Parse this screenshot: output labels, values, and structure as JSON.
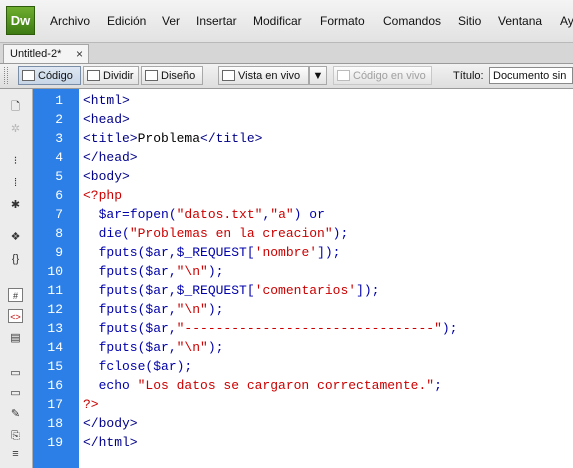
{
  "app": {
    "logo": "Dw"
  },
  "menu": [
    "Archivo",
    "Edición",
    "Ver",
    "Insertar",
    "Modificar",
    "Formato",
    "Comandos",
    "Sitio",
    "Ventana",
    "Ay"
  ],
  "tab": {
    "title": "Untitled-2*",
    "close": "×"
  },
  "toolbar": {
    "code_label": "Código",
    "split_label": "Dividir",
    "design_label": "Diseño",
    "live_view_label": "Vista en vivo",
    "live_code_label": "Código en vivo",
    "title_label": "Título:",
    "title_value": "Documento sin tí"
  },
  "colors": {
    "gutter": "#2b7fe7",
    "tag": "#000088",
    "php": "#cc0000",
    "string": "#cc0000",
    "func": "#0000aa"
  },
  "sidebar_icons": [
    "open-documents-icon",
    "show-code-navigator-icon",
    "collapse-full-tag-icon",
    "collapse-selection-icon",
    "expand-all-icon",
    "select-parent-tag-icon",
    "balance-braces-icon",
    "line-numbers-icon",
    "highlight-invalid-code-icon",
    "syntax-coloring-icon",
    "apply-comment-icon",
    "remove-comment-icon",
    "wrap-tag-icon",
    "recent-snippets-icon",
    "move-css-icon",
    "indent-code-icon"
  ],
  "code": {
    "line_numbers": [
      "1",
      "2",
      "3",
      "4",
      "5",
      "6",
      "7",
      "8",
      "9",
      "10",
      "11",
      "12",
      "13",
      "14",
      "15",
      "16",
      "17",
      "18",
      "19"
    ],
    "lines": [
      [
        {
          "t": "<html>",
          "c": "tag"
        }
      ],
      [
        {
          "t": "<head>",
          "c": "tag"
        }
      ],
      [
        {
          "t": "<title>",
          "c": "tag"
        },
        {
          "t": "Problema",
          "c": "txt"
        },
        {
          "t": "</title>",
          "c": "tag"
        }
      ],
      [
        {
          "t": "</head>",
          "c": "tag"
        }
      ],
      [
        {
          "t": "<body>",
          "c": "tag"
        }
      ],
      [
        {
          "t": "<?php",
          "c": "php"
        }
      ],
      [
        {
          "t": "  $ar=",
          "c": "fn"
        },
        {
          "t": "fopen(",
          "c": "fn"
        },
        {
          "t": "\"datos.txt\"",
          "c": "str"
        },
        {
          "t": ",",
          "c": "fn"
        },
        {
          "t": "\"a\"",
          "c": "str"
        },
        {
          "t": ") or",
          "c": "fn"
        }
      ],
      [
        {
          "t": "  die(",
          "c": "fn"
        },
        {
          "t": "\"Problemas en la creacion\"",
          "c": "str"
        },
        {
          "t": ");",
          "c": "fn"
        }
      ],
      [
        {
          "t": "  fputs($ar,$_REQUEST[",
          "c": "fn"
        },
        {
          "t": "'nombre'",
          "c": "str"
        },
        {
          "t": "]);",
          "c": "fn"
        }
      ],
      [
        {
          "t": "  fputs($ar,",
          "c": "fn"
        },
        {
          "t": "\"\\n\"",
          "c": "str"
        },
        {
          "t": ");",
          "c": "fn"
        }
      ],
      [
        {
          "t": "  fputs($ar,$_REQUEST[",
          "c": "fn"
        },
        {
          "t": "'comentarios'",
          "c": "str"
        },
        {
          "t": "]);",
          "c": "fn"
        }
      ],
      [
        {
          "t": "  fputs($ar,",
          "c": "fn"
        },
        {
          "t": "\"\\n\"",
          "c": "str"
        },
        {
          "t": ");",
          "c": "fn"
        }
      ],
      [
        {
          "t": "  fputs($ar,",
          "c": "fn"
        },
        {
          "t": "\"--------------------------------\"",
          "c": "str"
        },
        {
          "t": ");",
          "c": "fn"
        }
      ],
      [
        {
          "t": "  fputs($ar,",
          "c": "fn"
        },
        {
          "t": "\"\\n\"",
          "c": "str"
        },
        {
          "t": ");",
          "c": "fn"
        }
      ],
      [
        {
          "t": "  fclose($ar);",
          "c": "fn"
        }
      ],
      [
        {
          "t": "  echo ",
          "c": "fn"
        },
        {
          "t": "\"Los datos se cargaron correctamente.\"",
          "c": "str"
        },
        {
          "t": ";",
          "c": "fn"
        }
      ],
      [
        {
          "t": "?>",
          "c": "php"
        }
      ],
      [
        {
          "t": "</body>",
          "c": "tag"
        }
      ],
      [
        {
          "t": "</html>",
          "c": "tag"
        }
      ]
    ]
  }
}
